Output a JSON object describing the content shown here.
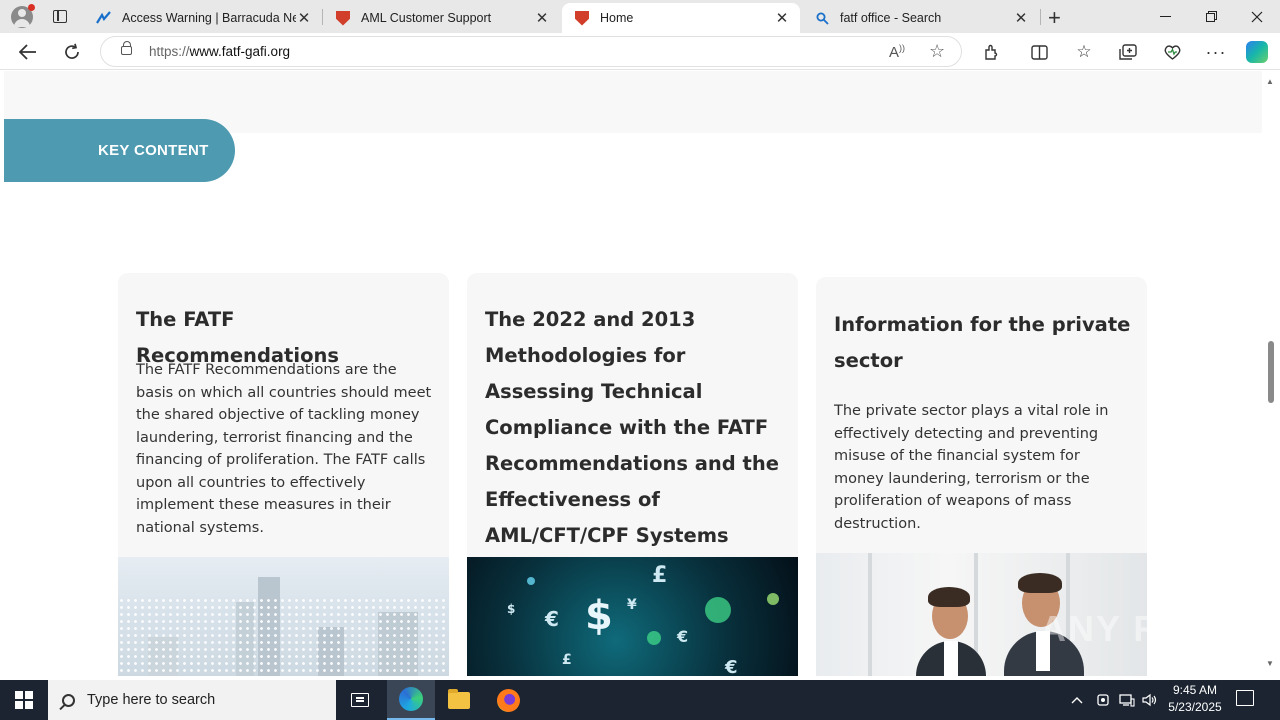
{
  "browser": {
    "tabs": [
      {
        "title": "Access Warning | Barracuda Networks",
        "active": false
      },
      {
        "title": "AML Customer Support",
        "active": false
      },
      {
        "title": "Home",
        "active": true
      },
      {
        "title": "fatf office - Search",
        "active": false
      }
    ],
    "url_scheme": "https://",
    "url_host": "www.fatf-gafi.org"
  },
  "page": {
    "section_label": "KEY CONTENT",
    "cards": [
      {
        "title": "The FATF Recommendations",
        "body": "The FATF Recommendations are the basis on which all countries should meet the shared objective of tackling money laundering, terrorist financing and the financing of proliferation. The FATF calls upon all countries to effectively implement these measures in their national systems."
      },
      {
        "title": "The 2022 and 2013 Methodologies for Assessing Technical Compliance with the FATF Recommendations and the Effectiveness of AML/CFT/CPF Systems",
        "body": ""
      },
      {
        "title": "Information for the private sector",
        "body": "The private sector plays a vital role in effectively detecting and preventing misuse of the financial system for money laundering, terrorism or the proliferation of weapons of mass destruction."
      }
    ],
    "watermark": "ANY RUN"
  },
  "taskbar": {
    "search_placeholder": "Type here to search",
    "time": "9:45 AM",
    "date": "5/23/2025"
  },
  "colors": {
    "accent": "#4d9ab1",
    "card_bg": "#f7f7f7",
    "taskbar": "#1b2430"
  }
}
